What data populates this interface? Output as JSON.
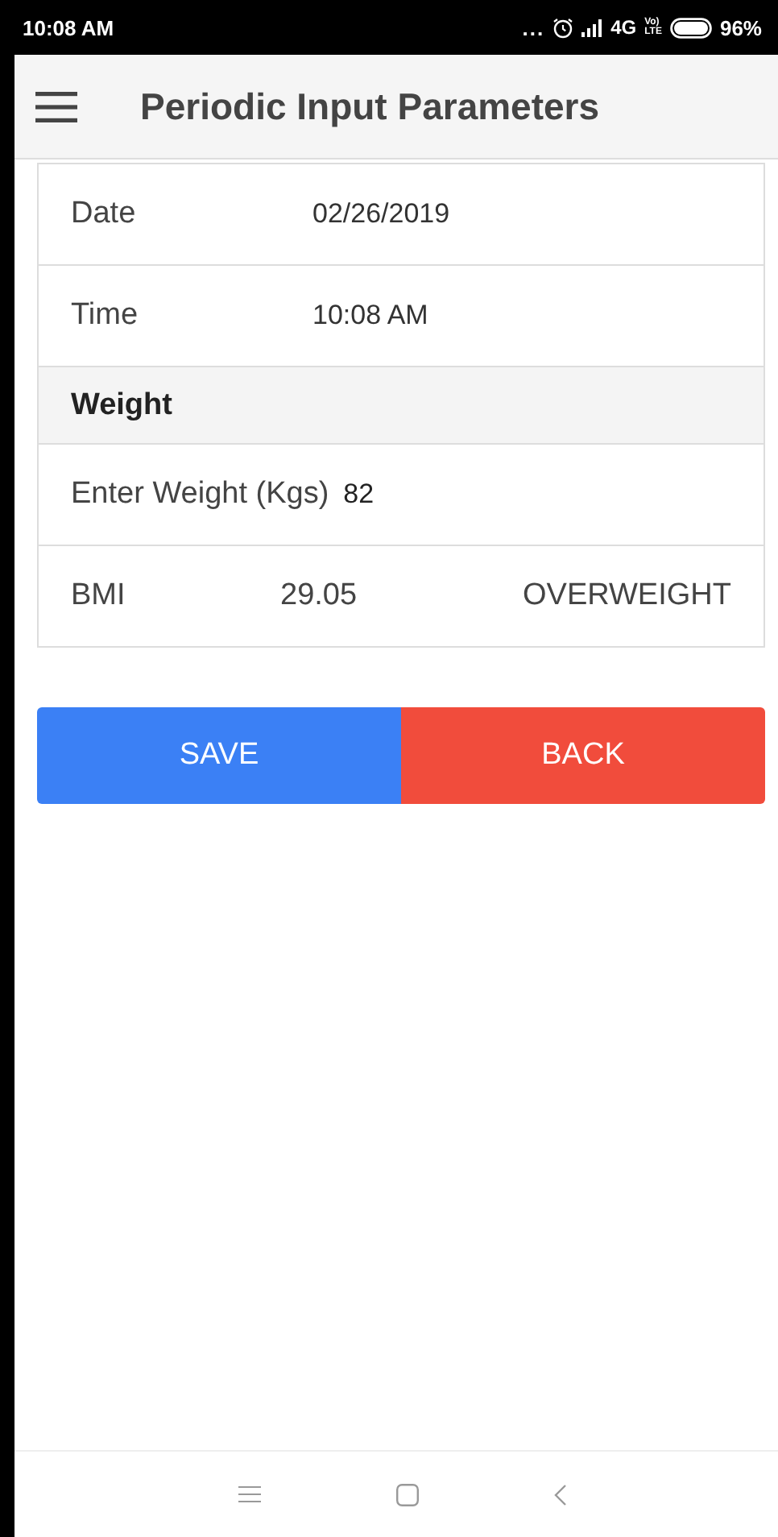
{
  "status_bar": {
    "time": "10:08 AM",
    "more": "...",
    "network": "4G",
    "volte_top": "Vo)",
    "volte_bottom": "LTE",
    "battery": "96%"
  },
  "app_bar": {
    "title": "Periodic Input Parameters"
  },
  "rows": [
    {
      "kind": "field",
      "label": "Date",
      "value": "02/26/2019"
    },
    {
      "kind": "field",
      "label": "Time",
      "value": "10:08 AM"
    },
    {
      "kind": "section",
      "label": "Weight"
    },
    {
      "kind": "input",
      "label": "Enter Weight (Kgs)",
      "value": "82"
    },
    {
      "kind": "result",
      "label": "BMI",
      "value": "29.05",
      "status": "OVERWEIGHT"
    }
  ],
  "buttons": [
    {
      "label": "SAVE",
      "kind": "primary"
    },
    {
      "label": "BACK",
      "kind": "danger"
    }
  ]
}
